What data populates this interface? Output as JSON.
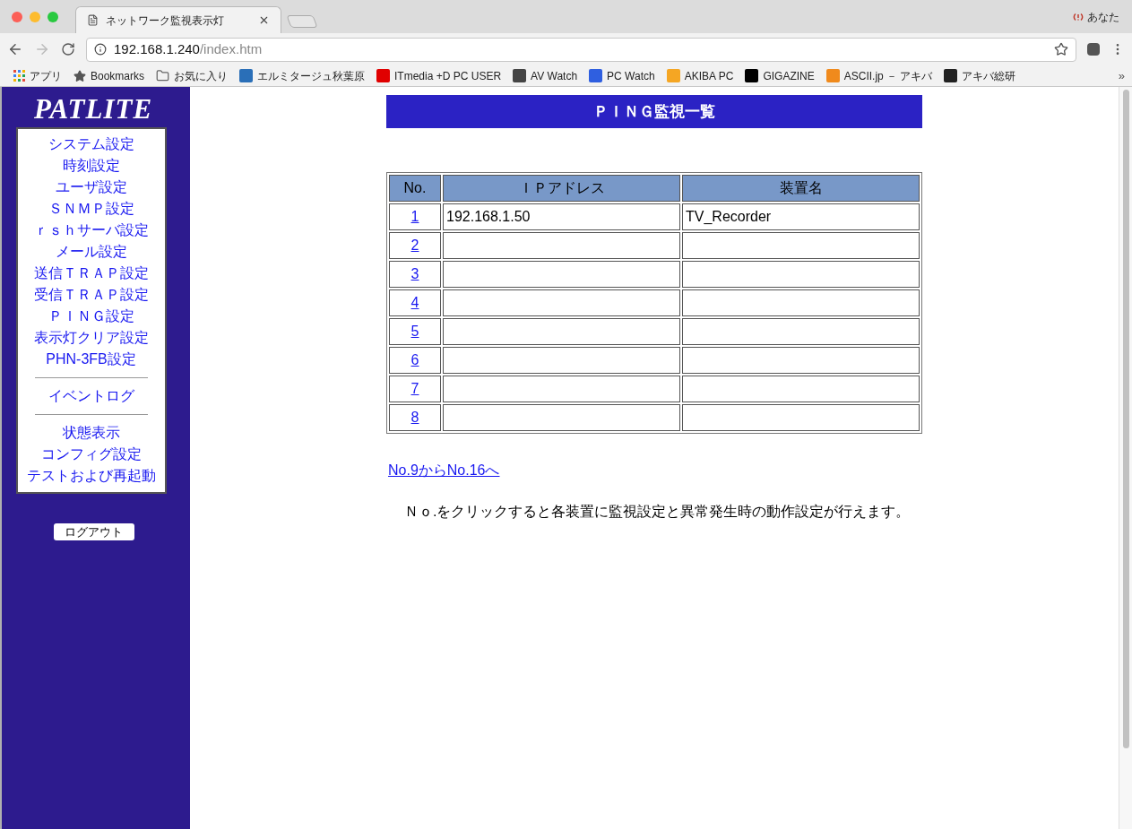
{
  "browser": {
    "tab_title": "ネットワーク監視表示灯",
    "profile": "あなた",
    "address_host": "192.168.1.240",
    "address_path": "/index.htm",
    "bookmarks": [
      {
        "label": "アプリ",
        "kind": "apps"
      },
      {
        "label": "Bookmarks",
        "kind": "star"
      },
      {
        "label": "お気に入り",
        "kind": "folder"
      },
      {
        "label": "エルミタージュ秋葉原",
        "kind": "site",
        "color": "#2a6fb8"
      },
      {
        "label": "ITmedia +D PC USER",
        "kind": "site",
        "color": "#e00000"
      },
      {
        "label": "AV Watch",
        "kind": "site",
        "color": "#444444"
      },
      {
        "label": "PC Watch",
        "kind": "site",
        "color": "#2f5fe0"
      },
      {
        "label": "AKIBA PC",
        "kind": "site",
        "color": "#f5a623"
      },
      {
        "label": "GIGAZINE",
        "kind": "site",
        "color": "#000000"
      },
      {
        "label": "ASCII.jp － アキバ",
        "kind": "site",
        "color": "#f08a1c"
      },
      {
        "label": "アキバ総研",
        "kind": "site",
        "color": "#222222"
      }
    ],
    "more": "»"
  },
  "sidebar": {
    "logo": "PATLITE",
    "menu_groups": [
      [
        "システム設定",
        "時刻設定",
        "ユーザ設定",
        "ＳＮＭＰ設定",
        "ｒｓｈサーバ設定",
        "メール設定",
        "送信ＴＲＡＰ設定",
        "受信ＴＲＡＰ設定",
        "ＰＩＮＧ設定",
        "表示灯クリア設定",
        "PHN-3FB設定"
      ],
      [
        "イベントログ"
      ],
      [
        "状態表示",
        "コンフィグ設定",
        "テストおよび再起動"
      ]
    ],
    "logout": "ログアウト"
  },
  "main": {
    "title": "ＰＩＮＧ監視一覧",
    "table": {
      "columns": [
        "No.",
        "ＩＰアドレス",
        "装置名"
      ],
      "rows": [
        {
          "no": "1",
          "ip": "192.168.1.50",
          "name": "TV_Recorder"
        },
        {
          "no": "2"
        },
        {
          "no": "3"
        },
        {
          "no": "4"
        },
        {
          "no": "5"
        },
        {
          "no": "6"
        },
        {
          "no": "7"
        },
        {
          "no": "8"
        }
      ]
    },
    "next_link": "No.9からNo.16へ",
    "note": "Ｎｏ.をクリックすると各装置に監視設定と異常発生時の動作設定が行えます。"
  }
}
